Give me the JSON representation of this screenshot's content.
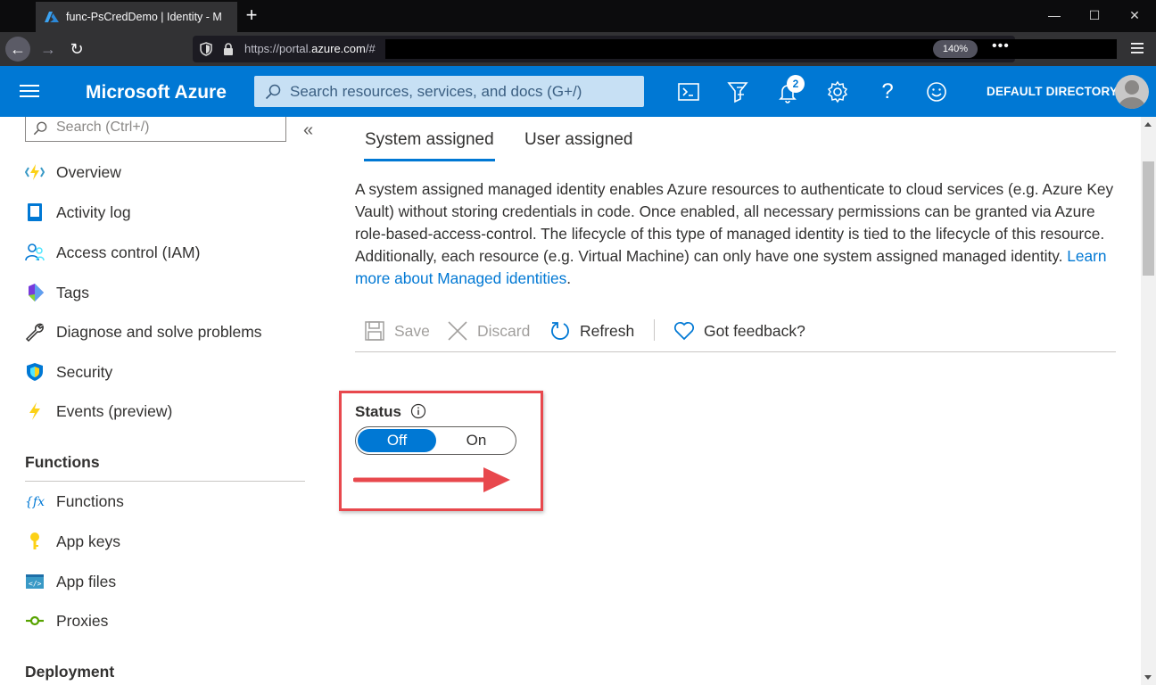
{
  "browser": {
    "tab_title": "func-PsCredDemo | Identity - M",
    "url_prefix": "https://portal.",
    "url_domain": "azure.com",
    "url_suffix": "/#",
    "zoom": "140%",
    "more": "•••"
  },
  "header": {
    "brand": "Microsoft Azure",
    "search_placeholder": "Search resources, services, and docs (G+/)",
    "notification_count": "2",
    "directory": "DEFAULT DIRECTORY"
  },
  "sidebar": {
    "search_placeholder": "Search (Ctrl+/)",
    "collapse": "«",
    "items": [
      {
        "label": "Overview",
        "icon": "function-app-icon"
      },
      {
        "label": "Activity log",
        "icon": "activity-log-icon"
      },
      {
        "label": "Access control (IAM)",
        "icon": "people-icon"
      },
      {
        "label": "Tags",
        "icon": "tag-icon"
      },
      {
        "label": "Diagnose and solve problems",
        "icon": "wrench-icon"
      },
      {
        "label": "Security",
        "icon": "shield-icon"
      },
      {
        "label": "Events (preview)",
        "icon": "lightning-icon"
      }
    ],
    "sections": [
      {
        "title": "Functions",
        "items": [
          {
            "label": "Functions",
            "icon": "fx-icon"
          },
          {
            "label": "App keys",
            "icon": "key-icon"
          },
          {
            "label": "App files",
            "icon": "code-file-icon"
          },
          {
            "label": "Proxies",
            "icon": "proxy-icon"
          }
        ]
      },
      {
        "title": "Deployment",
        "items": []
      }
    ]
  },
  "main": {
    "tabs": [
      {
        "label": "System assigned",
        "active": true
      },
      {
        "label": "User assigned",
        "active": false
      }
    ],
    "description": "A system assigned managed identity enables Azure resources to authenticate to cloud services (e.g. Azure Key Vault) without storing credentials in code. Once enabled, all necessary permissions can be granted via Azure role-based-access-control. The lifecycle of this type of managed identity is tied to the lifecycle of this resource. Additionally, each resource (e.g. Virtual Machine) can only have one system assigned managed identity. ",
    "learn_more": "Learn more about Managed identities",
    "learn_more_tail": ".",
    "toolbar": {
      "save": "Save",
      "discard": "Discard",
      "refresh": "Refresh",
      "feedback": "Got feedback?"
    },
    "status": {
      "label": "Status",
      "off": "Off",
      "on": "On",
      "selected": "Off"
    }
  },
  "colors": {
    "azure_blue": "#0078d4",
    "highlight_red": "#e8484d"
  }
}
